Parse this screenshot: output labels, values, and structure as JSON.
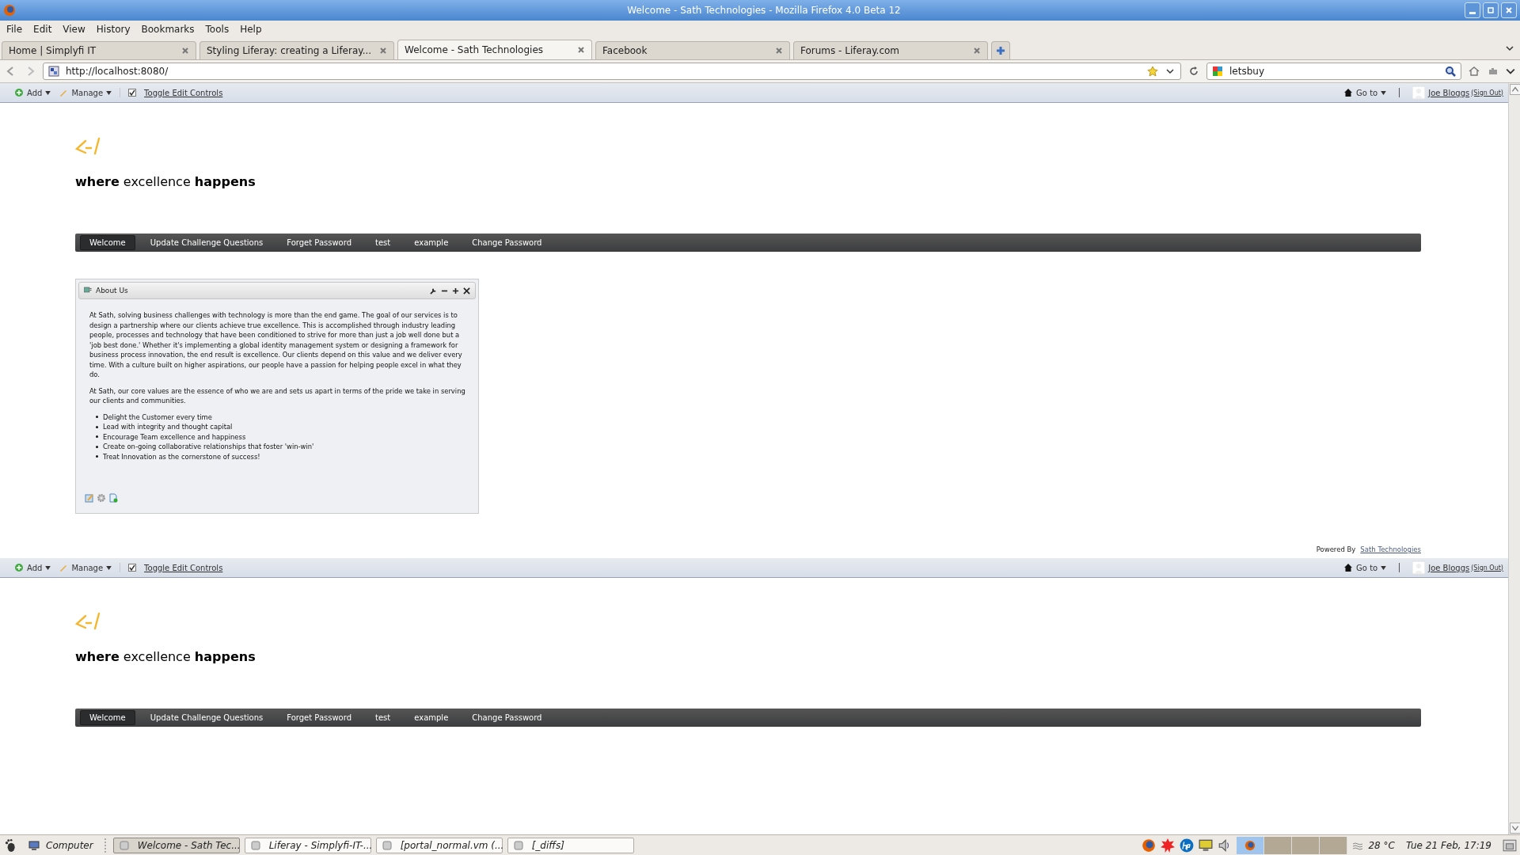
{
  "window": {
    "title": "Welcome - Sath Technologies - Mozilla Firefox 4.0 Beta 12"
  },
  "menu": [
    "File",
    "Edit",
    "View",
    "History",
    "Bookmarks",
    "Tools",
    "Help"
  ],
  "tabs": [
    {
      "label": "Home | Simplyfi IT",
      "selected": false
    },
    {
      "label": "Styling Liferay: creating a Liferay...",
      "selected": false
    },
    {
      "label": "Welcome - Sath Technologies",
      "selected": true
    },
    {
      "label": "Facebook",
      "selected": false
    },
    {
      "label": "Forums - Liferay.com",
      "selected": false
    }
  ],
  "address": {
    "value": "http://localhost:8080/"
  },
  "search": {
    "value": "letsbuy"
  },
  "sections": [
    {
      "dockbar": {
        "add": "Add",
        "manage": "Manage",
        "toggle": {
          "label": "Toggle Edit Controls",
          "checked": true
        },
        "goto": "Go to",
        "user": "Joe Bloggs",
        "sign_out": "(Sign Out)"
      },
      "tagline": "**where** excellence **happens**",
      "nav": [
        {
          "label": "Welcome",
          "selected": true
        },
        {
          "label": "Update Challenge Questions",
          "selected": false
        },
        {
          "label": "Forget Password",
          "selected": false
        },
        {
          "label": "test",
          "selected": false
        },
        {
          "label": "example",
          "selected": false
        },
        {
          "label": "Change Password",
          "selected": false
        }
      ],
      "portlet": {
        "title": "About Us",
        "paragraphs": [
          "At Sath, solving business challenges with technology is more than the end game.  The goal of our services is to design a partnership where our clients achieve true excellence.  This is accomplished through industry leading people, processes and technology that have been conditioned to strive for more than just a job well done but a 'job best done.'  Whether it's implementing a global identity management system or designing a framework for business process innovation, the end result is excellence.  Our clients depend on this value and we deliver every time. With a culture built on higher aspirations, our people have a passion for helping people excel in what they do.",
          "At Sath, our core values are the essence of who we are and sets us apart in terms of the pride we take in serving our clients and communities."
        ],
        "bullets": [
          "Delight the Customer every time",
          "Lead with integrity and thought capital",
          "Encourage Team excellence and happiness",
          "Create on-going collaborative relationships that foster 'win-win'",
          "Treat Innovation as the cornerstone of success!"
        ]
      },
      "footer": {
        "label": "Powered By",
        "link": "Sath Technologies"
      }
    },
    {
      "dockbar": {
        "add": "Add",
        "manage": "Manage",
        "toggle": {
          "label": "Toggle Edit Controls",
          "checked": true
        },
        "goto": "Go to",
        "user": "Joe Bloggs",
        "sign_out": "(Sign Out)"
      },
      "tagline": "**where** excellence **happens**",
      "nav": [
        {
          "label": "Welcome",
          "selected": true
        },
        {
          "label": "Update Challenge Questions",
          "selected": false
        },
        {
          "label": "Forget Password",
          "selected": false
        },
        {
          "label": "test",
          "selected": false
        },
        {
          "label": "example",
          "selected": false
        },
        {
          "label": "Change Password",
          "selected": false
        }
      ]
    }
  ],
  "taskbar": {
    "launcher": "Computer",
    "windows": [
      {
        "label": "Welcome - Sath Tec...",
        "selected": true
      },
      {
        "label": "Liferay - Simplyfi-IT-...",
        "selected": false
      },
      {
        "label": "[portal_normal.vm (...",
        "selected": false
      },
      {
        "label": "[_diffs]",
        "selected": false
      }
    ],
    "temperature": "28 °C",
    "clock": "Tue 21 Feb, 17:19"
  }
}
